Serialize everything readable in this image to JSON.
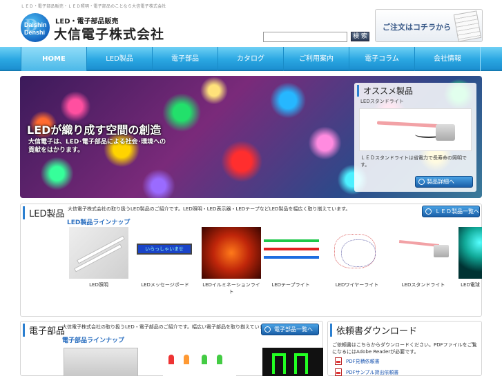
{
  "header": {
    "tagline": "ＬＥＤ・電子部品販売・ＬＥＤ照明・電子部品のことなら大信電子株式会社",
    "logo_sub": "LED・電子部品販売",
    "logo_name": "大信電子株式会社",
    "logo_mark_line1": "Daishin",
    "logo_mark_line2": "Denshi",
    "search_placeholder": "",
    "search_button": "検 索",
    "order_banner": "ご注文はコチラから"
  },
  "nav": {
    "items": [
      {
        "label": "HOME"
      },
      {
        "label": "LED製品"
      },
      {
        "label": "電子部品"
      },
      {
        "label": "カタログ"
      },
      {
        "label": "ご利用案内"
      },
      {
        "label": "電子コラム"
      },
      {
        "label": "会社情報"
      }
    ]
  },
  "hero": {
    "title": "LEDが織り成す空間の創造",
    "subtitle": "大信電子は、LED･電子部品による社会･環境への貢献をはかります。"
  },
  "recommend": {
    "title": "オススメ製品",
    "subtitle": "LEDスタンドライト",
    "description": "ＬＥＤスタンドライトは省電力で長寿命の照明です。",
    "button": "製品詳細へ"
  },
  "led_section": {
    "title": "LED製品",
    "description": "大信電子株式会社の取り扱うLED製品のご紹介です。LED照明・LED表示器・LEDテープなどLED製品を幅広く取り揃えています。",
    "list_button": "ＬＥＤ製品一覧へ",
    "lineup_title": "LED製品ラインナップ",
    "products": [
      {
        "label": "LED照明"
      },
      {
        "label": "LEDメッセージボード"
      },
      {
        "label": "LEDイルミネーションライト"
      },
      {
        "label": "LEDテープライト"
      },
      {
        "label": "LEDワイヤーライト"
      },
      {
        "label": "LEDスタンドライト"
      },
      {
        "label": "LED電球"
      }
    ]
  },
  "parts_section": {
    "title": "電子部品",
    "description": "大信電子株式会社の取り扱うLED・電子部品のご紹介です。幅広い電子部品を取り揃えています。",
    "list_button": "電子部品一覧へ",
    "lineup_title": "電子部品ラインナップ"
  },
  "download_section": {
    "title": "依頼書ダウンロード",
    "description": "ご依頼書はこちらからダウンロードください。PDFファイルをご覧になるにはAdobe Readerが必要です。",
    "links": [
      {
        "label": "PDF見積依頼書"
      },
      {
        "label": "PDFサンプル貸出依頼書"
      }
    ]
  },
  "colors": {
    "nav_blue": "#2aa7e2",
    "accent": "#2b7fd0",
    "button_blue": "#1a5fa8",
    "link": "#1a55b0"
  }
}
